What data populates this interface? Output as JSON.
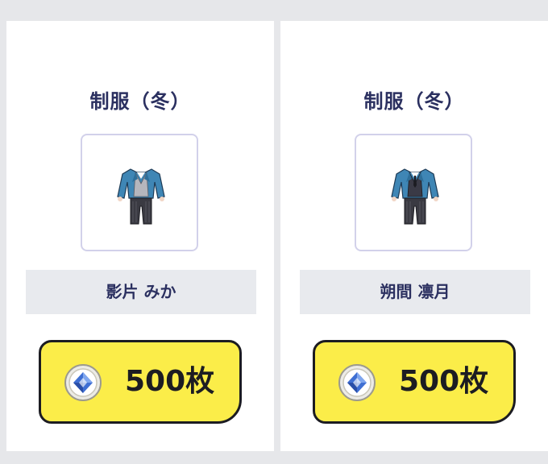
{
  "colors": {
    "background": "#e6e7ea",
    "card": "#ffffff",
    "title_text": "#2b3060",
    "name_bar": "#e8eaee",
    "button_fill": "#fbed49",
    "button_border": "#1c1c22",
    "jacket_blue": "#3f86b5",
    "pants_dark": "#3a3a42"
  },
  "items": [
    {
      "title": "制服（冬）",
      "character": "影片 みか",
      "price": "500枚",
      "icon": "outfit-winter-uniform-icon",
      "currency_icon": "diamond-coin-icon"
    },
    {
      "title": "制服（冬）",
      "character": "朔間 凛月",
      "price": "500枚",
      "icon": "outfit-winter-uniform-icon",
      "currency_icon": "diamond-coin-icon"
    }
  ]
}
